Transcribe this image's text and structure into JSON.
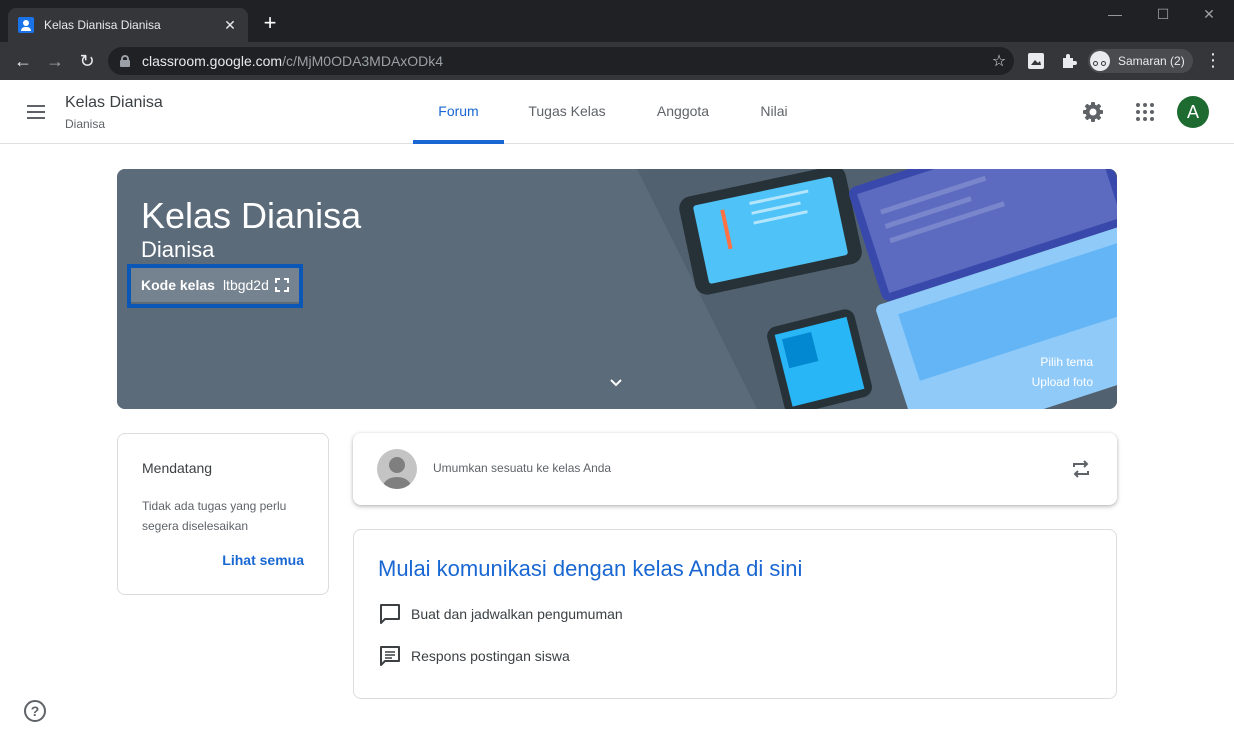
{
  "browser": {
    "tab_title": "Kelas Dianisa Dianisa",
    "tab_close": "✕",
    "new_tab": "+",
    "window_min": "—",
    "window_max": "☐",
    "window_close": "✕",
    "url_host": "classroom.google.com",
    "url_path": "/c/MjM0ODA3MDAxODk4",
    "profile_label": "Samaran (2)",
    "back": "←",
    "forward": "→",
    "reload": "↻",
    "star": "☆",
    "menu": "⋮"
  },
  "header": {
    "class_title": "Kelas Dianisa",
    "class_sub": "Dianisa",
    "tabs": [
      {
        "label": "Forum",
        "active": true
      },
      {
        "label": "Tugas Kelas",
        "active": false
      },
      {
        "label": "Anggota",
        "active": false
      },
      {
        "label": "Nilai",
        "active": false
      }
    ],
    "avatar_letter": "A",
    "avatar_color": "#1e6b32"
  },
  "banner": {
    "title": "Kelas Dianisa",
    "subtitle": "Dianisa",
    "code_label": "Kode kelas",
    "code_value": "ltbgd2d",
    "choose_theme": "Pilih tema",
    "upload_photo": "Upload foto",
    "background_color": "#5a6b7b"
  },
  "upcoming": {
    "title": "Mendatang",
    "text": "Tidak ada tugas yang perlu segera diselesaikan",
    "link": "Lihat semua"
  },
  "announce": {
    "placeholder": "Umumkan sesuatu ke kelas Anda"
  },
  "communicate": {
    "title": "Mulai komunikasi dengan kelas Anda di sini",
    "items": [
      {
        "label": "Buat dan jadwalkan pengumuman",
        "icon": "feedback-icon"
      },
      {
        "label": "Respons postingan siswa",
        "icon": "comment-icon"
      }
    ]
  },
  "help": {
    "symbol": "?"
  },
  "colors": {
    "accent": "#1967d2",
    "highlight_box": "#0b57b8"
  }
}
